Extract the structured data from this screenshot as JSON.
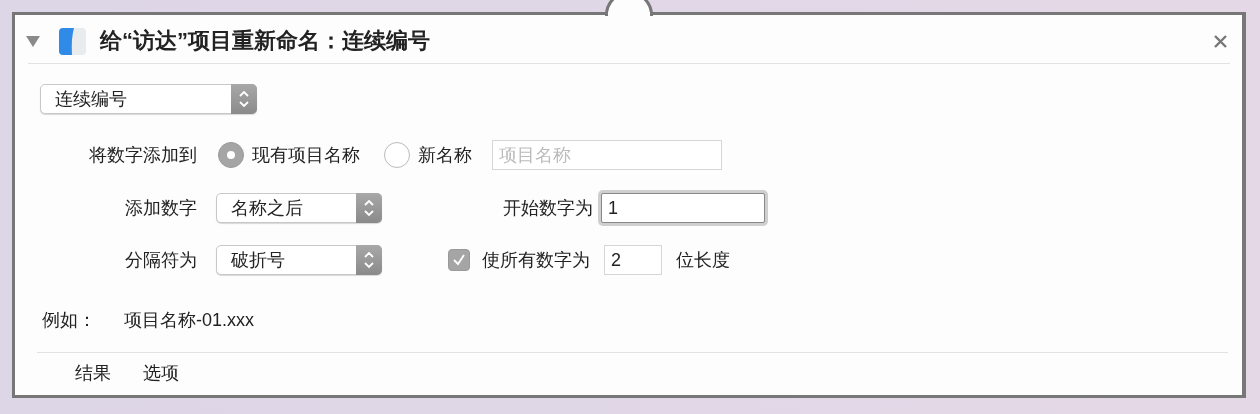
{
  "panel": {
    "title": "给“访达”项目重新命名：连续编号",
    "expanded": true
  },
  "mode_popup": {
    "value": "连续编号"
  },
  "add_number_to": {
    "label": "将数字添加到",
    "options": [
      {
        "label": "现有项目名称",
        "selected": true
      },
      {
        "label": "新名称",
        "selected": false
      }
    ],
    "new_name_field": {
      "placeholder": "项目名称"
    }
  },
  "where": {
    "label": "添加数字",
    "value": "名称之后"
  },
  "start": {
    "label": "开始数字为",
    "value": "1",
    "focused": true
  },
  "separator": {
    "label": "分隔符为",
    "value": "破折号"
  },
  "digits": {
    "checked": true,
    "label": "使所有数字为",
    "value": "2",
    "suffix": "位长度"
  },
  "example": {
    "label": "例如：",
    "value": "项目名称-01.xxx"
  },
  "footer_tabs": [
    {
      "label": "结果"
    },
    {
      "label": "选项"
    }
  ]
}
